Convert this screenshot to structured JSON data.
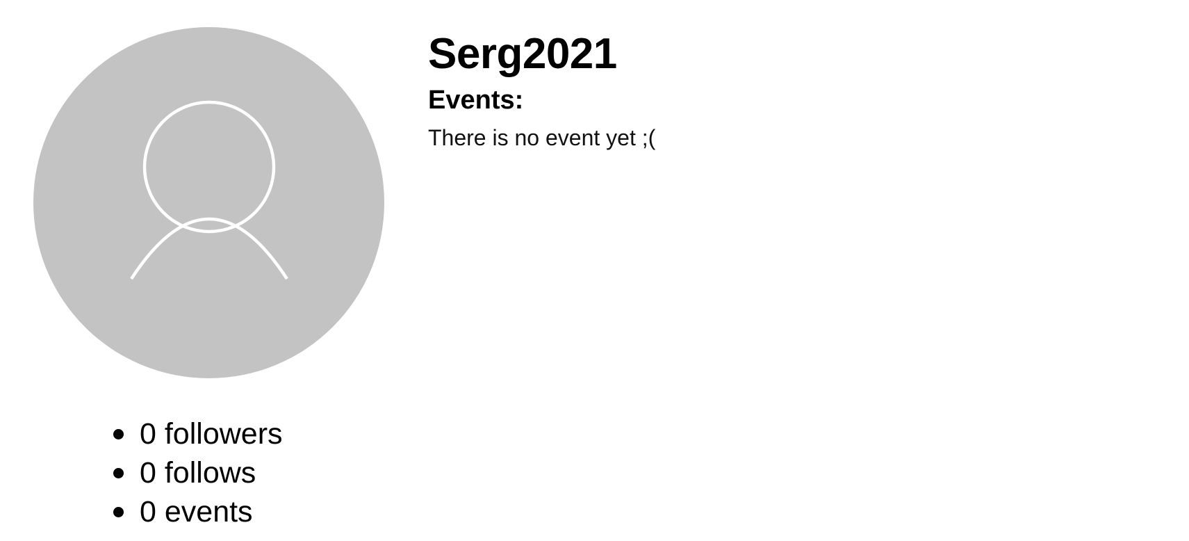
{
  "profile": {
    "username": "Serg2021",
    "avatar_icon": "user-silhouette-icon",
    "avatar_background": "#c3c3c3",
    "avatar_stroke": "#ffffff"
  },
  "events": {
    "heading": "Events:",
    "empty_message": "There is no event yet ;("
  },
  "stats": [
    {
      "label": "0 followers"
    },
    {
      "label": "0 follows"
    },
    {
      "label": "0 events"
    }
  ]
}
